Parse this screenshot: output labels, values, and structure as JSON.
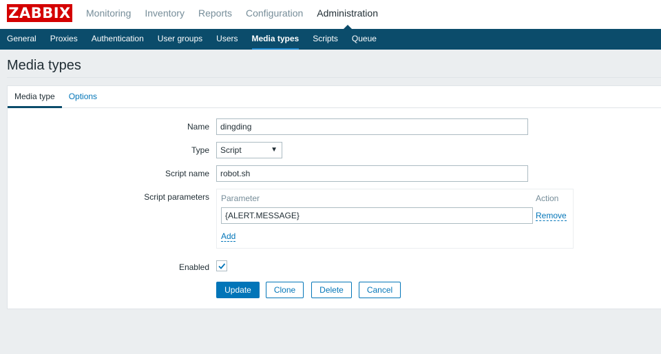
{
  "header": {
    "logo_text": "ZABBIX",
    "menu": [
      "Monitoring",
      "Inventory",
      "Reports",
      "Configuration",
      "Administration"
    ],
    "active_menu": "Administration"
  },
  "submenu": {
    "items": [
      "General",
      "Proxies",
      "Authentication",
      "User groups",
      "Users",
      "Media types",
      "Scripts",
      "Queue"
    ],
    "active": "Media types"
  },
  "page": {
    "title": "Media types"
  },
  "tabs": [
    "Media type",
    "Options"
  ],
  "form": {
    "name_label": "Name",
    "name_value": "dingding",
    "type_label": "Type",
    "type_value": "Script",
    "script_name_label": "Script name",
    "script_name_value": "robot.sh",
    "script_params_label": "Script parameters",
    "params_header_parameter": "Parameter",
    "params_header_action": "Action",
    "params": [
      {
        "value": "{ALERT.MESSAGE}",
        "action": "Remove"
      }
    ],
    "add_label": "Add",
    "enabled_label": "Enabled",
    "enabled": true
  },
  "buttons": {
    "update": "Update",
    "clone": "Clone",
    "delete": "Delete",
    "cancel": "Cancel"
  },
  "colors": {
    "brand_red": "#d40000",
    "nav_blue": "#0b4c6b",
    "link_blue": "#0275b8"
  }
}
